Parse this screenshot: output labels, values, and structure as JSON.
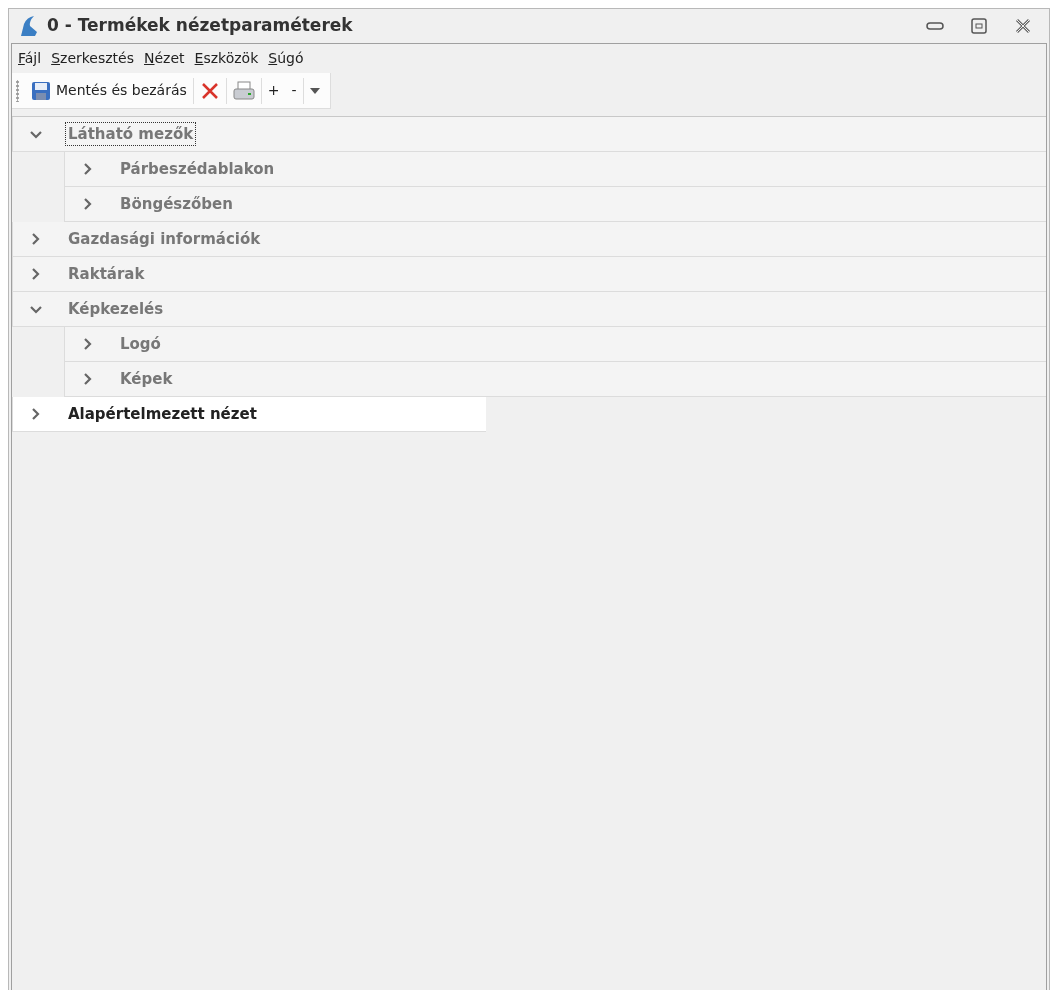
{
  "window": {
    "title": "0 - Termékek nézetparaméterek"
  },
  "menu": [
    "Fájl",
    "Szerkesztés",
    "Nézet",
    "Eszközök",
    "Súgó"
  ],
  "toolbar": [
    {
      "kind": "save",
      "label": "Mentés és bezárás"
    },
    {
      "kind": "delete"
    },
    {
      "kind": "print"
    },
    {
      "kind": "text",
      "label": "+"
    },
    {
      "kind": "text",
      "label": "-"
    },
    {
      "kind": "dropdown"
    }
  ],
  "tree": [
    {
      "label": "Látható mezők",
      "expanded": true,
      "focused": true,
      "selected": false,
      "children": [
        {
          "label": "Párbeszédablakon",
          "expanded": false,
          "focused": false,
          "selected": false
        },
        {
          "label": "Böngészőben",
          "expanded": false,
          "focused": false,
          "selected": false
        }
      ]
    },
    {
      "label": "Gazdasági információk",
      "expanded": false,
      "focused": false,
      "selected": false
    },
    {
      "label": "Raktárak",
      "expanded": false,
      "focused": false,
      "selected": false
    },
    {
      "label": "Képkezelés",
      "expanded": true,
      "focused": false,
      "selected": false,
      "children": [
        {
          "label": "Logó",
          "expanded": false,
          "focused": false,
          "selected": false
        },
        {
          "label": "Képek",
          "expanded": false,
          "focused": false,
          "selected": false
        }
      ]
    },
    {
      "label": "Alapértelmezett nézet",
      "expanded": false,
      "focused": false,
      "selected": true
    }
  ]
}
